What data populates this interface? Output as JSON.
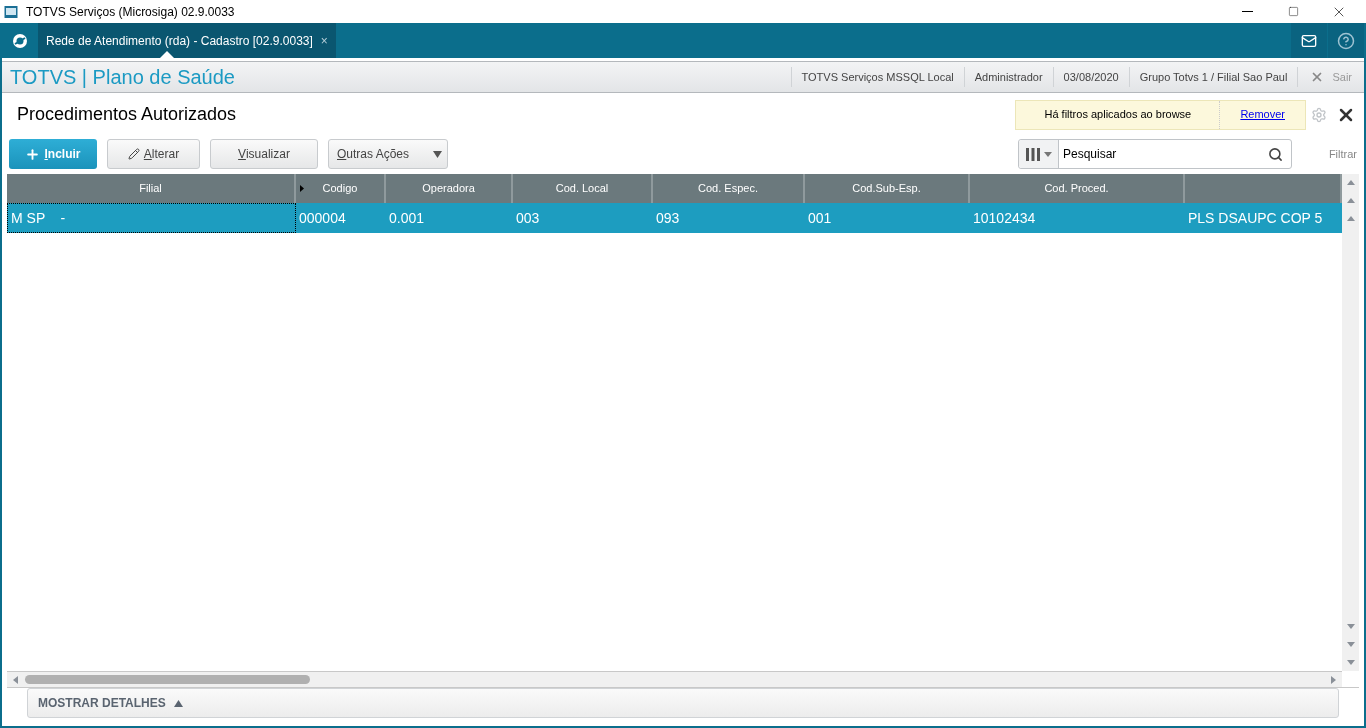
{
  "window": {
    "title": "TOTVS Serviços (Microsiga) 02.9.0033"
  },
  "tabs": [
    {
      "label": "Rede de Atendimento (rda) - Cadastro [02.9.0033]",
      "selected": true,
      "close": "×"
    }
  ],
  "header": {
    "brand": "TOTVS | Plano de Saúde",
    "info": [
      "TOTVS Serviços MSSQL Local",
      "Administrador",
      "03/08/2020",
      "Grupo Totvs 1 / Filial Sao Paul"
    ],
    "exit": "Sair"
  },
  "page": {
    "title": "Procedimentos Autorizados",
    "filter_notice": "Há filtros aplicados ao browse",
    "remove_link": "Remover"
  },
  "actions": [
    {
      "label": "Incluir",
      "kind": "primary"
    },
    {
      "label": "Alterar",
      "kind": "edit"
    },
    {
      "label": "Visualizar",
      "kind": "plain"
    },
    {
      "label": "Outras Ações",
      "kind": "menu"
    }
  ],
  "search": {
    "placeholder": "Pesquisar",
    "filter_label": "Filtrar"
  },
  "table": {
    "columns": [
      "Filial",
      "Codigo",
      "Operadora",
      "Cod. Local",
      "Cod. Espec.",
      "Cod.Sub-Esp.",
      "Cod. Proced.",
      ""
    ],
    "rows": [
      {
        "selected": true,
        "cells": [
          "M SP    -",
          "000004",
          "0.001",
          "003",
          "093",
          "001",
          "10102434",
          "PLS DSAUPC COP 5"
        ]
      }
    ]
  },
  "details": {
    "label": "MOSTRAR DETALHES"
  }
}
